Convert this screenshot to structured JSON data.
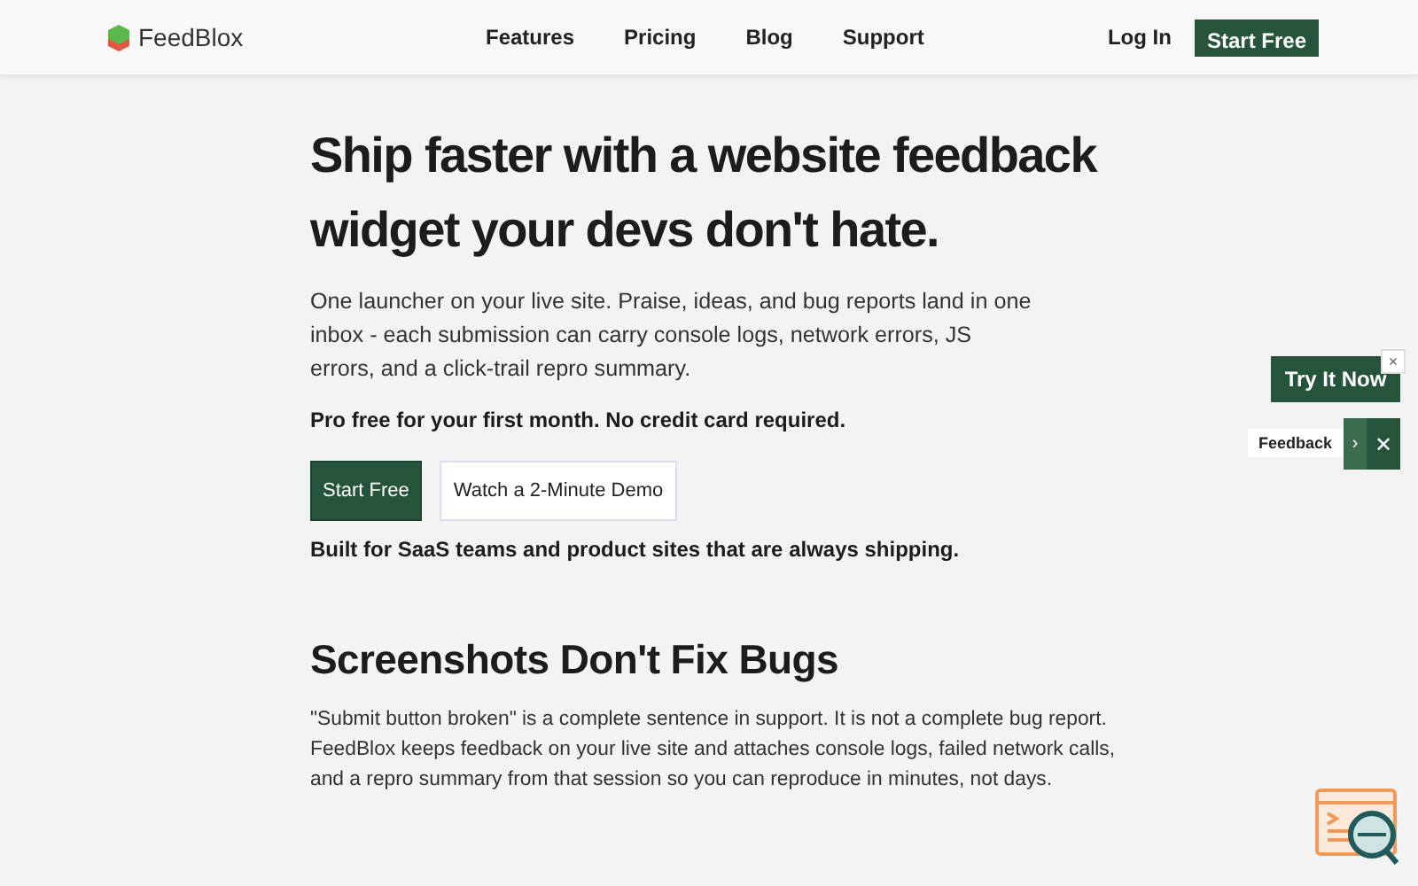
{
  "header": {
    "brand": "FeedBlox",
    "nav": [
      "Features",
      "Pricing",
      "Blog",
      "Support"
    ],
    "login": "Log In",
    "cta": "Start Free"
  },
  "hero": {
    "title": "Ship faster with a website feedback widget your devs don't hate.",
    "lead": "One launcher on your live site. Praise, ideas, and bug reports land in one inbox - each submission can carry console logs, network errors, JS errors, and a click-trail repro summary.",
    "offer": "Pro free for your first month. No credit card required.",
    "primary_button": "Start Free",
    "secondary_button": "Watch a 2-Minute Demo",
    "note": "Built for SaaS teams and product sites that are always shipping."
  },
  "section": {
    "title": "Screenshots Don't Fix Bugs",
    "body": "\"Submit button broken\" is a complete sentence in support. It is not a complete bug report. FeedBlox keeps feedback on your live site and attaches console logs, failed network calls, and a repro summary from that session so you can reproduce in minutes, not days."
  },
  "widget": {
    "try_button": "Try It Now",
    "dismiss": "×",
    "tab_label": "Feedback",
    "expand": "›",
    "close": "✕"
  }
}
